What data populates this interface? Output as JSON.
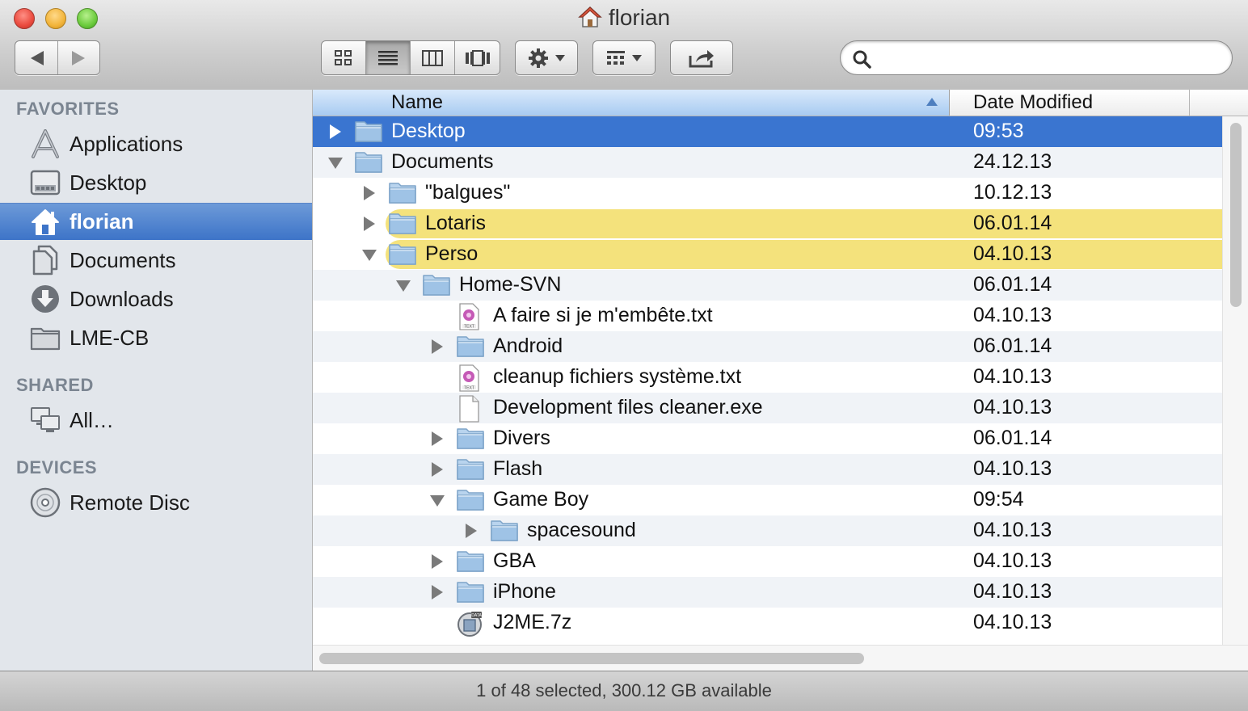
{
  "window": {
    "title": "florian"
  },
  "search": {
    "placeholder": "",
    "value": ""
  },
  "sidebar": {
    "favorites_label": "FAVORITES",
    "favorites": [
      {
        "label": "Applications",
        "icon": "applications-icon"
      },
      {
        "label": "Desktop",
        "icon": "desktop-icon"
      },
      {
        "label": "florian",
        "icon": "home-icon",
        "selected": true
      },
      {
        "label": "Documents",
        "icon": "documents-icon"
      },
      {
        "label": "Downloads",
        "icon": "downloads-icon"
      },
      {
        "label": "LME-CB",
        "icon": "folder-icon"
      }
    ],
    "shared_label": "SHARED",
    "shared": [
      {
        "label": "All…",
        "icon": "network-icon"
      }
    ],
    "devices_label": "DEVICES",
    "devices": [
      {
        "label": "Remote Disc",
        "icon": "disc-icon"
      }
    ]
  },
  "columns": {
    "name": "Name",
    "date": "Date Modified",
    "sort": "ascending"
  },
  "files": [
    {
      "name": "Desktop",
      "date": "09:53",
      "depth": 0,
      "type": "folder",
      "disclosure": "closed",
      "selected": true
    },
    {
      "name": "Documents",
      "date": "24.12.13",
      "depth": 0,
      "type": "folder",
      "disclosure": "open"
    },
    {
      "name": "\"balgues\"",
      "date": "10.12.13",
      "depth": 1,
      "type": "folder",
      "disclosure": "closed"
    },
    {
      "name": "Lotaris",
      "date": "06.01.14",
      "depth": 1,
      "type": "folder",
      "disclosure": "closed",
      "label_color": "#f4e27c"
    },
    {
      "name": "Perso",
      "date": "04.10.13",
      "depth": 1,
      "type": "folder",
      "disclosure": "open",
      "label_color": "#f4e27c"
    },
    {
      "name": "Home-SVN",
      "date": "06.01.14",
      "depth": 2,
      "type": "folder",
      "disclosure": "open"
    },
    {
      "name": "A faire si je m'embête.txt",
      "date": "04.10.13",
      "depth": 3,
      "type": "text",
      "disclosure": "none"
    },
    {
      "name": "Android",
      "date": "06.01.14",
      "depth": 3,
      "type": "folder",
      "disclosure": "closed"
    },
    {
      "name": "cleanup fichiers système.txt",
      "date": "04.10.13",
      "depth": 3,
      "type": "text",
      "disclosure": "none"
    },
    {
      "name": "Development files cleaner.exe",
      "date": "04.10.13",
      "depth": 3,
      "type": "document",
      "disclosure": "none"
    },
    {
      "name": "Divers",
      "date": "06.01.14",
      "depth": 3,
      "type": "folder",
      "disclosure": "closed"
    },
    {
      "name": "Flash",
      "date": "04.10.13",
      "depth": 3,
      "type": "folder",
      "disclosure": "closed"
    },
    {
      "name": "Game Boy",
      "date": "09:54",
      "depth": 3,
      "type": "folder",
      "disclosure": "open"
    },
    {
      "name": "spacesound",
      "date": "04.10.13",
      "depth": 4,
      "type": "folder",
      "disclosure": "closed"
    },
    {
      "name": "GBA",
      "date": "04.10.13",
      "depth": 3,
      "type": "folder",
      "disclosure": "closed"
    },
    {
      "name": "iPhone",
      "date": "04.10.13",
      "depth": 3,
      "type": "folder",
      "disclosure": "closed"
    },
    {
      "name": "J2ME.7z",
      "date": "04.10.13",
      "depth": 3,
      "type": "archive",
      "disclosure": "none"
    }
  ],
  "status": {
    "text": "1 of 48 selected, 300.12 GB available"
  },
  "colors": {
    "selection": "#3a75d0",
    "sidebar_selection": "#3d74c8",
    "yellow_label": "#f4e27c",
    "folder": "#9fc3e6"
  }
}
